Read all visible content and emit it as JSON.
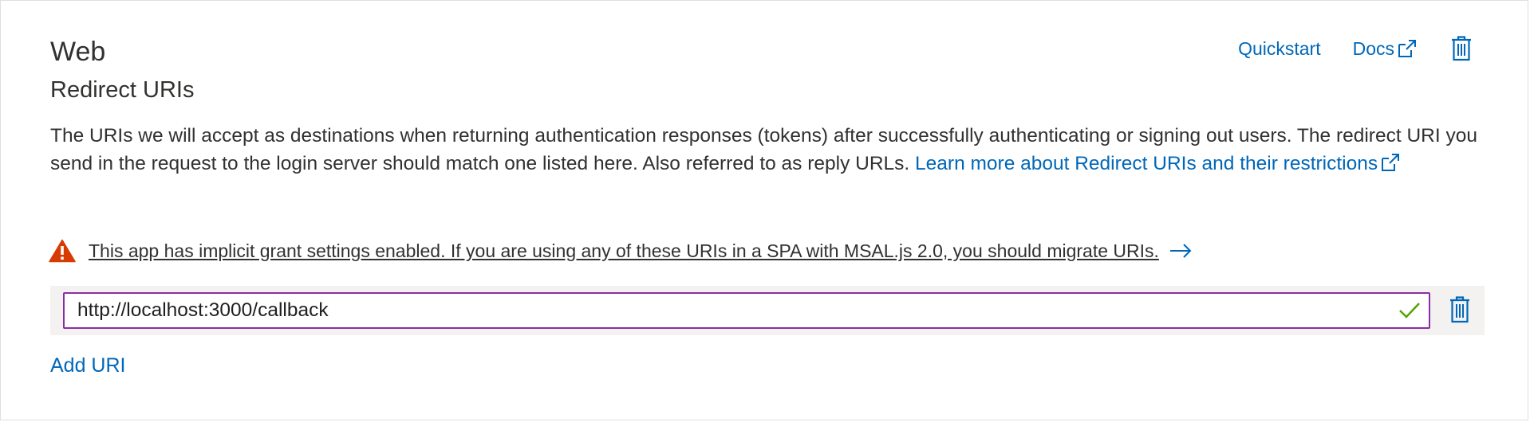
{
  "section": {
    "title": "Web",
    "subtitle": "Redirect URIs"
  },
  "actions": {
    "quickstart_label": "Quickstart",
    "docs_label": "Docs",
    "delete_icon": "trash-icon"
  },
  "description": {
    "text": "The URIs we will accept as destinations when returning authentication responses (tokens) after successfully authenticating or signing out users. The redirect URI you send in the request to the login server should match one listed here. Also referred to as reply URLs. ",
    "link_label": "Learn more about Redirect URIs and their restrictions"
  },
  "warning": {
    "icon": "warning-icon",
    "text": "This app has implicit grant settings enabled. If you are using any of these URIs in a SPA with MSAL.js 2.0, you should migrate URIs.",
    "arrow_icon": "arrow-right-icon"
  },
  "redirect_uris": [
    {
      "value": "http://localhost:3000/callback",
      "valid": true
    }
  ],
  "add_uri_label": "Add URI",
  "colors": {
    "link": "#0067b8",
    "warning": "#d83b01",
    "input_border": "#8a2da5",
    "check": "#57a300",
    "row_bg": "#f3f2f1"
  }
}
